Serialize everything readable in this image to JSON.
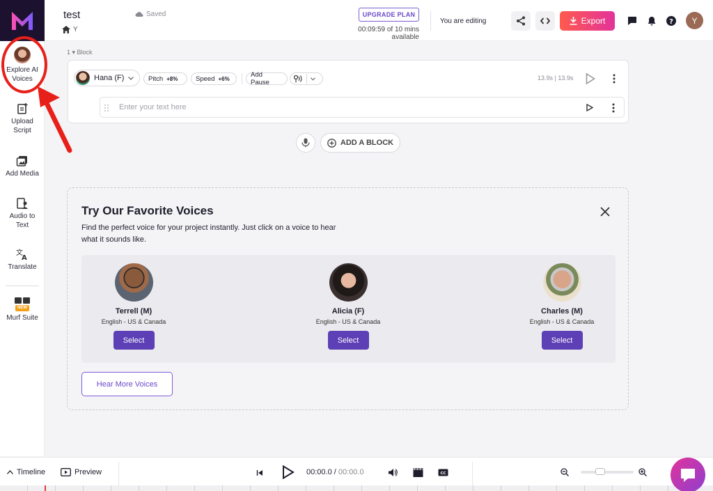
{
  "app": {
    "logo": "murf-logo"
  },
  "sidebar": {
    "items": [
      {
        "label_line1": "Explore AI",
        "label_line2": "Voices",
        "icon": "avatar-icon"
      },
      {
        "label_line1": "Upload",
        "label_line2": "Script",
        "icon": "upload-script-icon"
      },
      {
        "label_line1": "Add Media",
        "label_line2": "",
        "icon": "media-icon"
      },
      {
        "label_line1": "Audio to",
        "label_line2": "Text",
        "icon": "audio-to-text-icon"
      },
      {
        "label_line1": "Translate",
        "label_line2": "",
        "icon": "translate-icon"
      },
      {
        "label_line1": "Murf Suite",
        "label_line2": "",
        "icon": "murf-suite-icon",
        "badge": "NEW"
      }
    ]
  },
  "header": {
    "project_title": "test",
    "saved_status": "Saved",
    "breadcrumb": "Y",
    "upgrade_label": "UPGRADE PLAN",
    "time_available": "00:09:59 of 10 mins available",
    "editing_status": "You are editing",
    "export_label": "Export",
    "user_initial": "Y"
  },
  "editor": {
    "block_label": "1 ▾  Block",
    "voice_name": "Hana (F)",
    "pitch_label": "Pitch",
    "pitch_value": "+8%",
    "speed_label": "Speed",
    "speed_value": "+6%",
    "add_pause_label": "Add Pause",
    "block_time": "13.9s | 13.9s",
    "text_placeholder": "Enter your text here",
    "add_block_label": "ADD A BLOCK"
  },
  "voices_panel": {
    "title": "Try Our Favorite Voices",
    "description": "Find the perfect voice for your project instantly. Just click on a voice to hear what it sounds like.",
    "voices": [
      {
        "name": "Terrell (M)",
        "lang": "English - US & Canada",
        "select": "Select"
      },
      {
        "name": "Alicia (F)",
        "lang": "English - US & Canada",
        "select": "Select"
      },
      {
        "name": "Charles (M)",
        "lang": "English - US & Canada",
        "select": "Select"
      }
    ],
    "hear_more_label": "Hear More Voices"
  },
  "bottombar": {
    "timeline_label": "Timeline",
    "preview_label": "Preview",
    "current_time": "00:00.0",
    "total_time": "00:00.0"
  },
  "colors": {
    "accent": "#5d3fb6",
    "export_start": "#ff5a4e",
    "export_end": "#e2339a",
    "annotation": "#e8201a"
  }
}
